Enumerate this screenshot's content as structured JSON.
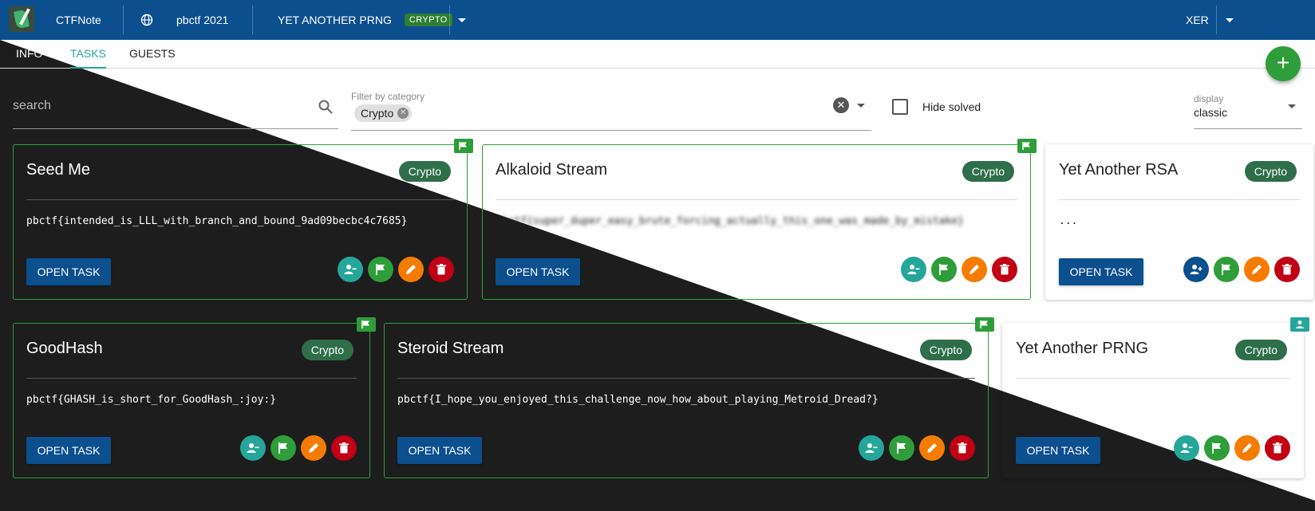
{
  "app": {
    "name": "CTFNote",
    "user": "XER"
  },
  "header": {
    "ctf_name": "pbctf 2021",
    "task_name": "YET ANOTHER PRNG",
    "task_tag": "CRYPTO"
  },
  "tabs": [
    {
      "label": "INFO"
    },
    {
      "label": "TASKS"
    },
    {
      "label": "GUESTS"
    }
  ],
  "search": {
    "placeholder": "search"
  },
  "filter": {
    "label": "Filter by category",
    "chip": "Crypto"
  },
  "hide_solved": {
    "label": "Hide solved"
  },
  "display": {
    "label": "display",
    "value": "classic"
  },
  "cards": [
    {
      "title": "Seed Me",
      "badge": "Crypto",
      "text": "pbctf{intended_is_LLL_with_branch_and_bound_9ad09becbc4c7685}",
      "button": "OPEN TASK",
      "solved": true
    },
    {
      "title": "Alkaloid Stream",
      "badge": "Crypto",
      "text": "pbctf{super_duper_easy_brute_forcing_actually_this_one_was_made_by_mistake}",
      "button": "OPEN TASK",
      "solved": true
    },
    {
      "title": "Yet Another RSA",
      "badge": "Crypto",
      "text": "...",
      "button": "OPEN TASK",
      "solved": false
    },
    {
      "title": "GoodHash",
      "badge": "Crypto",
      "text": "pbctf{GHASH_is_short_for_GoodHash_:joy:}",
      "button": "OPEN TASK",
      "solved": true
    },
    {
      "title": "Steroid Stream",
      "badge": "Crypto",
      "text": "pbctf{I_hope_you_enjoyed_this_challenge_now_how_about_playing_Metroid_Dread?}",
      "button": "OPEN TASK",
      "solved": true
    },
    {
      "title": "Yet Another PRNG",
      "badge": "Crypto",
      "text": "...",
      "button": "OPEN TASK",
      "solved": false
    }
  ],
  "icons": {
    "globe": "globe-icon",
    "search": "search-icon",
    "flag": "flag-icon",
    "user_remove": "person-remove-icon",
    "user_add": "person-add-icon",
    "edit": "pencil-icon",
    "delete": "trash-icon"
  },
  "colors": {
    "header": "#0b4f8f",
    "accent": "#26a69a",
    "solved": "#2e9d3a",
    "danger": "#c10015",
    "edit": "#f57c00"
  }
}
